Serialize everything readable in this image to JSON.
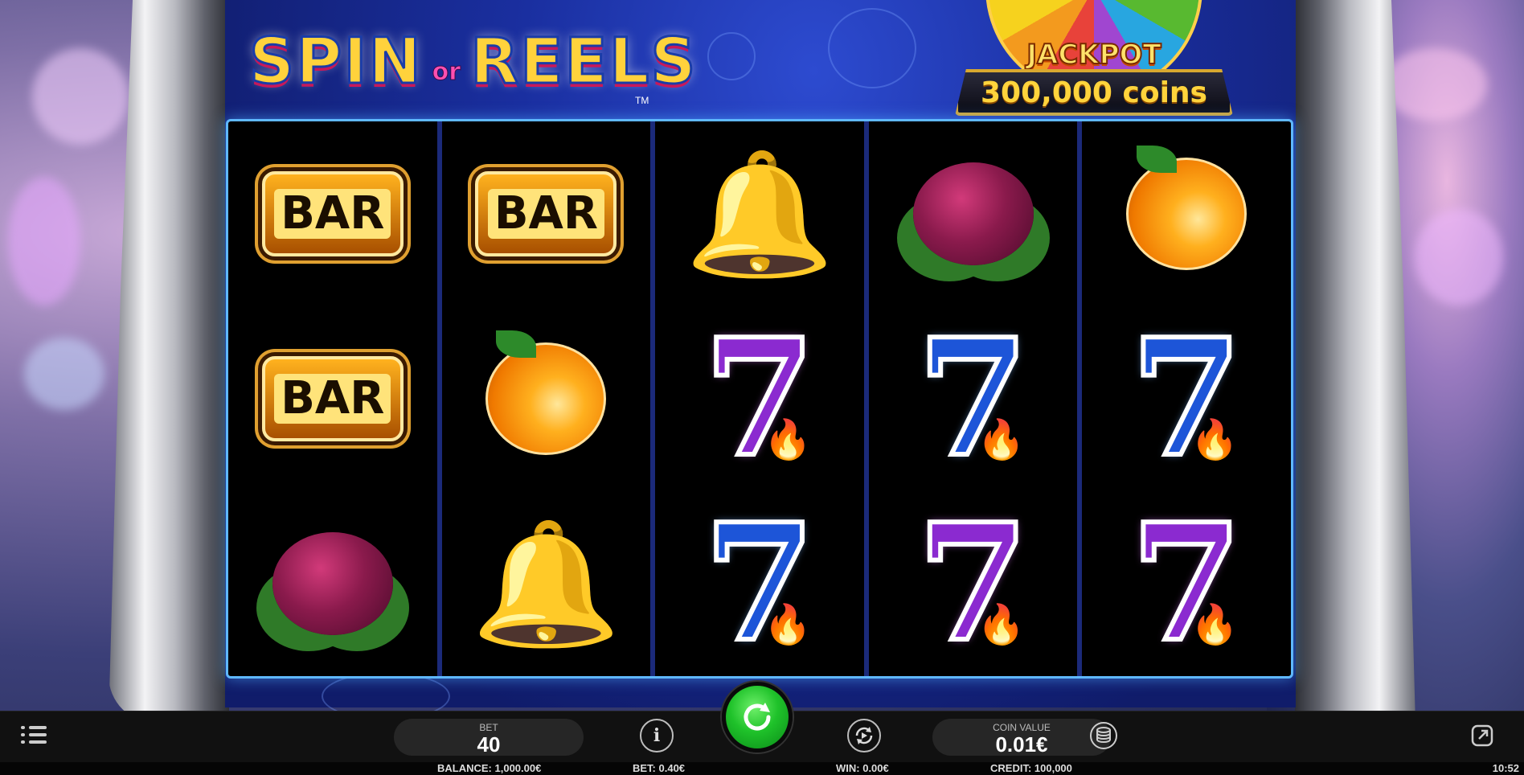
{
  "game": {
    "logo_word1": "SPIN",
    "logo_or": "or",
    "logo_word2": "REELS",
    "logo_tm": "TM"
  },
  "jackpot": {
    "title": "JACKPOT",
    "amount": "300,000 coins"
  },
  "reels": [
    [
      "bar",
      "bar",
      "plum"
    ],
    [
      "bar",
      "orange",
      "bell"
    ],
    [
      "bell",
      "seven-purple",
      "seven-blue"
    ],
    [
      "plum",
      "seven-blue",
      "seven-purple"
    ],
    [
      "orange",
      "seven-blue",
      "seven-purple"
    ]
  ],
  "symbols": {
    "bar_label": "BAR",
    "seven_label": "7"
  },
  "controls": {
    "bet_label": "BET",
    "bet_value": "40",
    "coin_value_label": "COIN VALUE",
    "coin_value": "0.01€"
  },
  "status": {
    "balance": "BALANCE: 1,000.00€",
    "bet": "BET: 0.40€",
    "win": "WIN: 0.00€",
    "credit": "CREDIT: 100,000",
    "time": "10:52"
  },
  "colors": {
    "spin_button": "#1fc22a",
    "reel_frame": "#5fb8ff",
    "machine_blue": "#1a2fa0"
  }
}
